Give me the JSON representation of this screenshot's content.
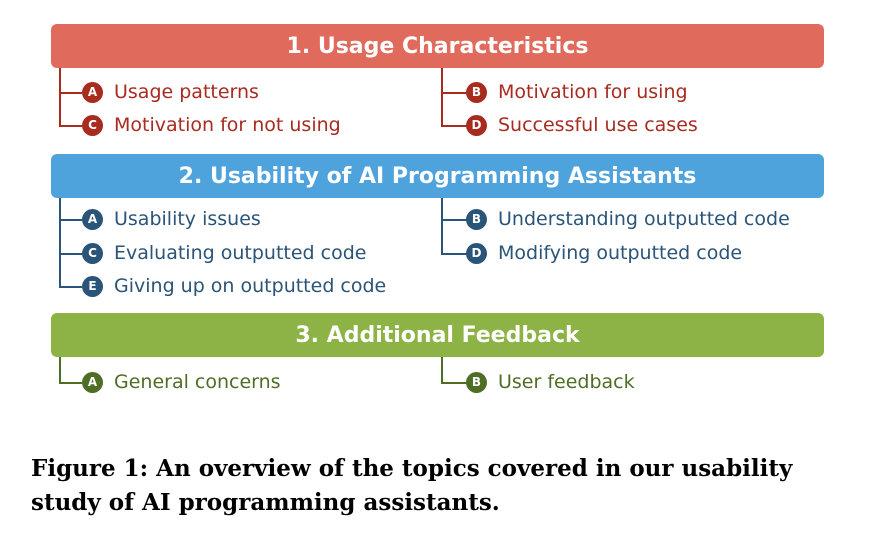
{
  "sections": [
    {
      "title": "1. Usage Characteristics",
      "color": "#E06B5D",
      "accent": "#A82B20",
      "items": [
        {
          "badge": "A",
          "label": "Usage patterns"
        },
        {
          "badge": "B",
          "label": "Motivation for using"
        },
        {
          "badge": "C",
          "label": "Motivation for not using"
        },
        {
          "badge": "D",
          "label": "Successful use cases"
        }
      ]
    },
    {
      "title": "2. Usability of AI Programming Assistants",
      "color": "#4FA3DC",
      "accent": "#2A5478",
      "items": [
        {
          "badge": "A",
          "label": "Usability issues"
        },
        {
          "badge": "B",
          "label": "Understanding outputted code"
        },
        {
          "badge": "C",
          "label": "Evaluating outputted code"
        },
        {
          "badge": "D",
          "label": "Modifying outputted code"
        },
        {
          "badge": "E",
          "label": "Giving up on outputted code"
        }
      ]
    },
    {
      "title": "3. Additional Feedback",
      "color": "#8DB346",
      "accent": "#4F6E25",
      "items": [
        {
          "badge": "A",
          "label": "General concerns"
        },
        {
          "badge": "B",
          "label": "User feedback"
        }
      ]
    }
  ],
  "caption": "Figure 1: An overview of the topics covered in our usability study of AI programming assistants."
}
